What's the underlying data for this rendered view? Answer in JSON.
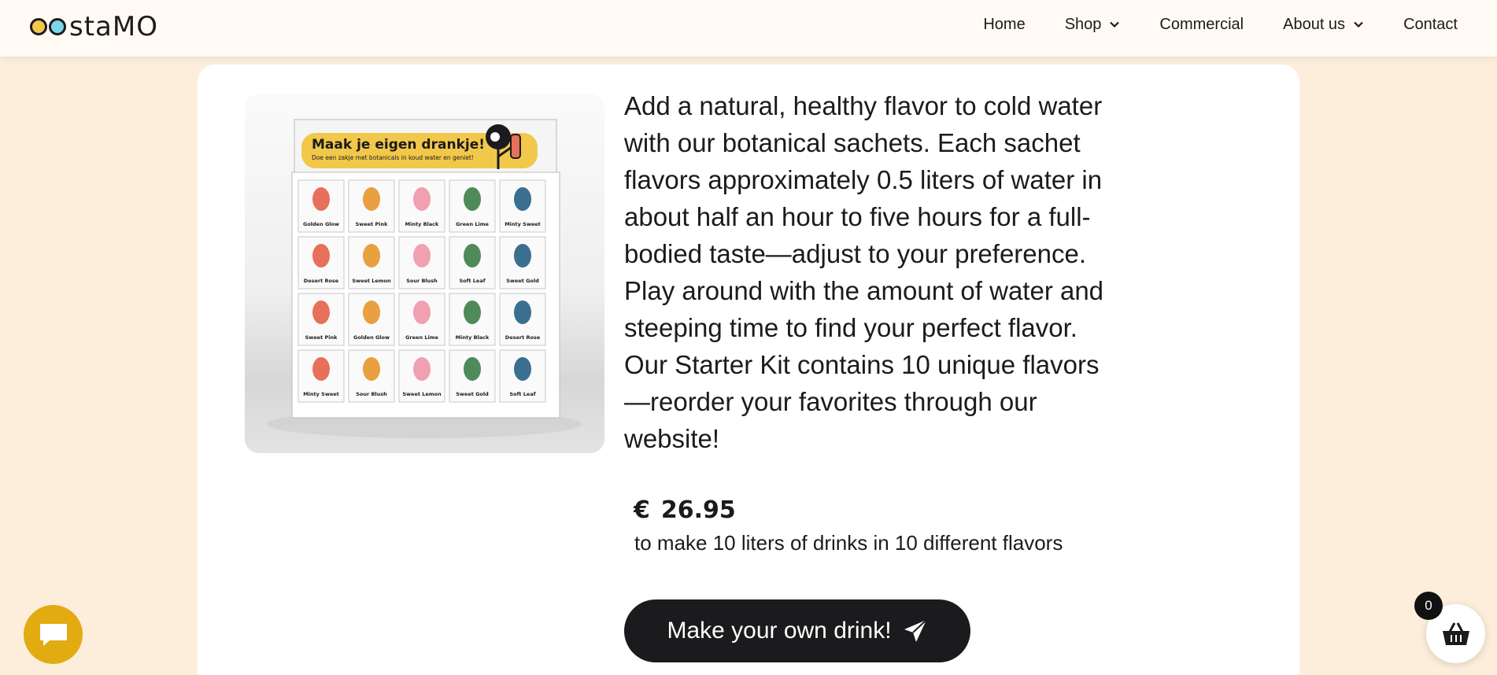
{
  "header": {
    "logo_text": "oostaMO",
    "nav": [
      {
        "label": "Home",
        "has_dropdown": false
      },
      {
        "label": "Shop",
        "has_dropdown": true
      },
      {
        "label": "Commercial",
        "has_dropdown": false
      },
      {
        "label": "About us",
        "has_dropdown": true
      },
      {
        "label": "Contact",
        "has_dropdown": false
      }
    ]
  },
  "product": {
    "banner_title": "Maak je eigen drankje!",
    "banner_subtitle": "Doe een zakje met botanicals in koud water en geniet!",
    "sachets": [
      "Golden Glow",
      "Sweet Pink",
      "Minty Black",
      "Green Lime",
      "Minty Sweet",
      "Desert Rose",
      "Sweet Lemon",
      "Sour Blush",
      "Soft Leaf",
      "Sweet Gold",
      "Sweet Pink",
      "Golden Glow",
      "Green Lime",
      "Minty Black",
      "Desert Rose",
      "Minty Sweet",
      "Sour Blush",
      "Sweet Lemon",
      "Sweet Gold",
      "Soft Leaf"
    ],
    "description": "Add a natural, healthy flavor to cold water with our botanical sachets. Each sachet flavors approximately 0.5 liters of water in about half an hour to five hours for a full-bodied taste—adjust to your preference. Play around with the amount of water and steeping time to find your perfect flavor. Our Starter Kit contains 10 unique flavors—reorder your favorites through our website!",
    "currency": "€",
    "price": "26.95",
    "price_note": "to make 10 liters of drinks in 10 different flavors",
    "cta_label": "Make your own drink!"
  },
  "cart": {
    "count": "0"
  },
  "colors": {
    "page_bg": "#fdeedb",
    "header_bg": "#fffaf3",
    "dark": "#1b1b1e",
    "chat_accent": "#e3ab12",
    "logo_yellow": "#f2c84a",
    "logo_blue": "#7ed6e8"
  },
  "icons": {
    "chat": "chat-bubble-icon",
    "cart": "basket-icon",
    "cta": "paper-plane-icon",
    "dropdown": "chevron-down-icon"
  }
}
